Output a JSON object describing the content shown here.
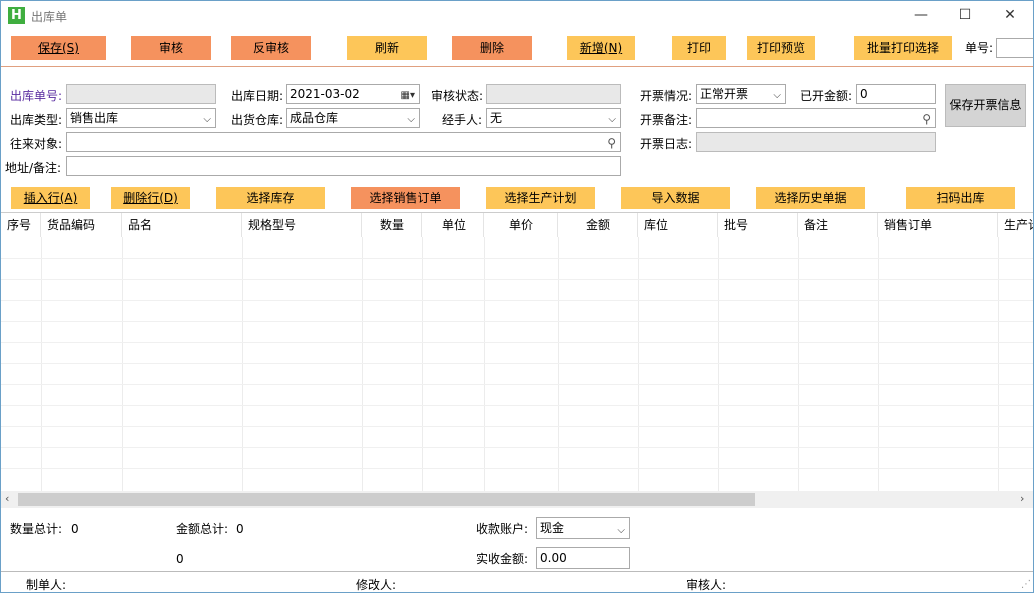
{
  "window": {
    "title": "出库单",
    "icon_letter": "H",
    "min_glyph": "—",
    "max_glyph": "☐",
    "close_glyph": "✕"
  },
  "toolbar": {
    "save": "保存(S)",
    "audit": "审核",
    "unaudit": "反审核",
    "refresh": "刷新",
    "delete": "删除",
    "new": "新增(N)",
    "print": "打印",
    "print_preview": "打印预览",
    "batch_print": "批量打印选择",
    "order_no_label": "单号:"
  },
  "form": {
    "out_no_label": "出库单号:",
    "out_no_value": "",
    "out_date_label": "出库日期:",
    "out_date_value": "2021-03-02",
    "audit_status_label": "审核状态:",
    "audit_status_value": "",
    "invoice_status_label": "开票情况:",
    "invoice_status_value": "正常开票",
    "invoiced_amount_label": "已开金额:",
    "invoiced_amount_value": "0",
    "out_type_label": "出库类型:",
    "out_type_value": "销售出库",
    "warehouse_label": "出货仓库:",
    "warehouse_value": "成品仓库",
    "handler_label": "经手人:",
    "handler_value": "无",
    "invoice_note_label": "开票备注:",
    "invoice_note_value": "",
    "partner_label": "往来对象:",
    "partner_value": "",
    "invoice_log_label": "开票日志:",
    "invoice_log_value": "",
    "address_label": "地址/备注:",
    "address_value": "",
    "save_invoice_button": "保存开票信息"
  },
  "actions": {
    "insert_row": "插入行(A)",
    "delete_row": "删除行(D)",
    "select_stock": "选择库存",
    "select_sales_order": "选择销售订单",
    "select_production_plan": "选择生产计划",
    "import_data": "导入数据",
    "select_history": "选择历史单据",
    "scan_out": "扫码出库"
  },
  "grid": {
    "columns": [
      "序号",
      "货品编码",
      "品名",
      "规格型号",
      "数量",
      "单位",
      "单价",
      "金额",
      "库位",
      "批号",
      "备注",
      "销售订单",
      "生产计"
    ],
    "rows": []
  },
  "summary": {
    "qty_total_label": "数量总计:",
    "qty_total_value": "0",
    "amount_total_label": "金额总计:",
    "amount_total_value": "0",
    "extra_value": "0",
    "account_label": "收款账户:",
    "account_value": "现金",
    "received_label": "实收金额:",
    "received_value": "0.00"
  },
  "footer": {
    "creator_label": "制单人:",
    "modifier_label": "修改人:",
    "auditor_label": "审核人:"
  },
  "icons": {
    "calendar": "calendar-icon",
    "search": "search-icon",
    "chevron": "chevron-down-icon"
  },
  "colors": {
    "orange_button": "#f5925e",
    "yellow_button": "#fdc659",
    "label_purple": "#5a2ca0",
    "app_icon_green": "#3fae3f"
  }
}
